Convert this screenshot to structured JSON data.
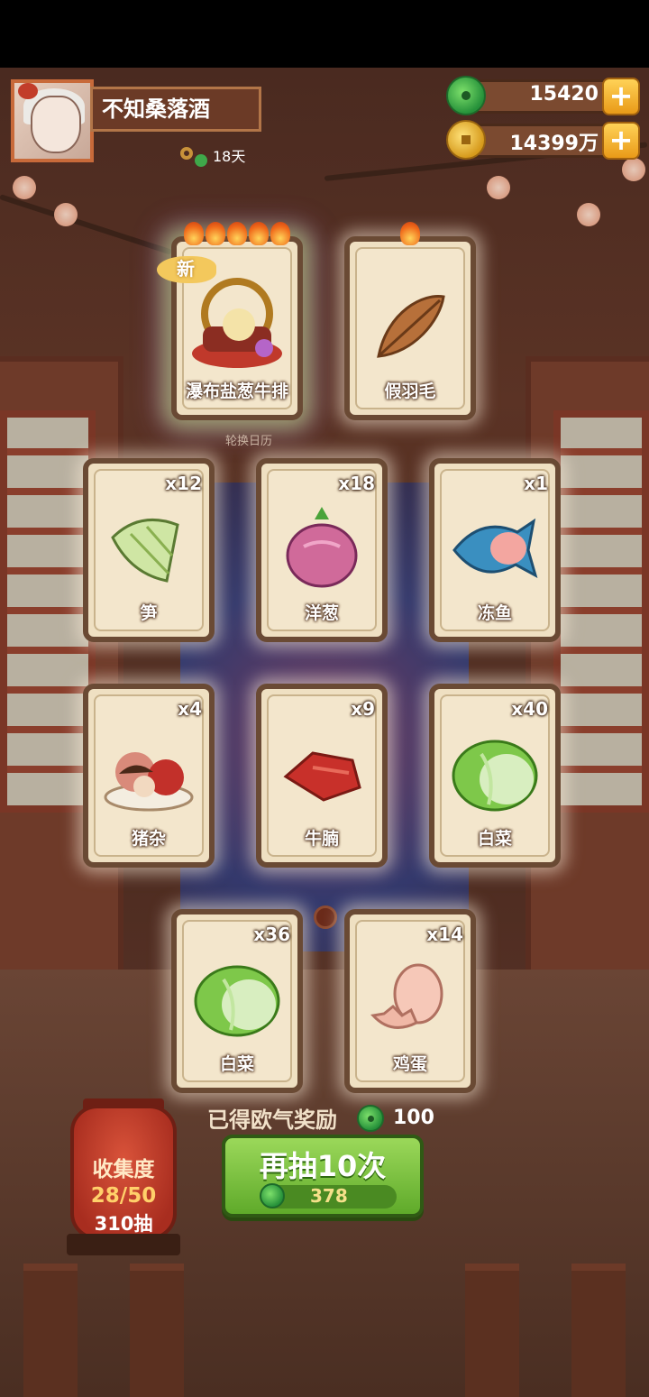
{
  "header": {
    "player_name": "不知桑落酒",
    "days": "18天",
    "currencies": [
      {
        "icon": "jade-icon",
        "value": "15420"
      },
      {
        "icon": "coin-icon",
        "value": "14399万"
      }
    ],
    "plus_label": "+"
  },
  "featured": [
    {
      "name": "瀑布盐葱牛排",
      "flames": 5,
      "is_new": true,
      "new_label": "新"
    },
    {
      "name": "假羽毛",
      "flames": 1,
      "is_new": false
    }
  ],
  "rotate_label": "轮换日历",
  "cards": [
    {
      "name": "笋",
      "qty": "x12",
      "icon": "bamboo-shoot-icon"
    },
    {
      "name": "洋葱",
      "qty": "x18",
      "icon": "onion-icon"
    },
    {
      "name": "冻鱼",
      "qty": "x1",
      "icon": "frozen-fish-icon"
    },
    {
      "name": "猪杂",
      "qty": "x4",
      "icon": "pork-offal-icon"
    },
    {
      "name": "牛腩",
      "qty": "x9",
      "icon": "beef-brisket-icon"
    },
    {
      "name": "白菜",
      "qty": "x40",
      "icon": "cabbage-icon"
    },
    {
      "name": "白菜",
      "qty": "x36",
      "icon": "cabbage-icon"
    },
    {
      "name": "鸡蛋",
      "qty": "x14",
      "icon": "egg-icon"
    }
  ],
  "reward": {
    "label": "已得欧气奖励",
    "amount": "100"
  },
  "collection": {
    "title": "收集度",
    "progress": "28/50",
    "draws": "310抽"
  },
  "draw_button": {
    "label": "再抽10次",
    "cost": "378"
  },
  "colors": {
    "jade": "#26913a",
    "gold": "#e99a18",
    "card": "#efe0c2",
    "button": "#5faa2a"
  }
}
